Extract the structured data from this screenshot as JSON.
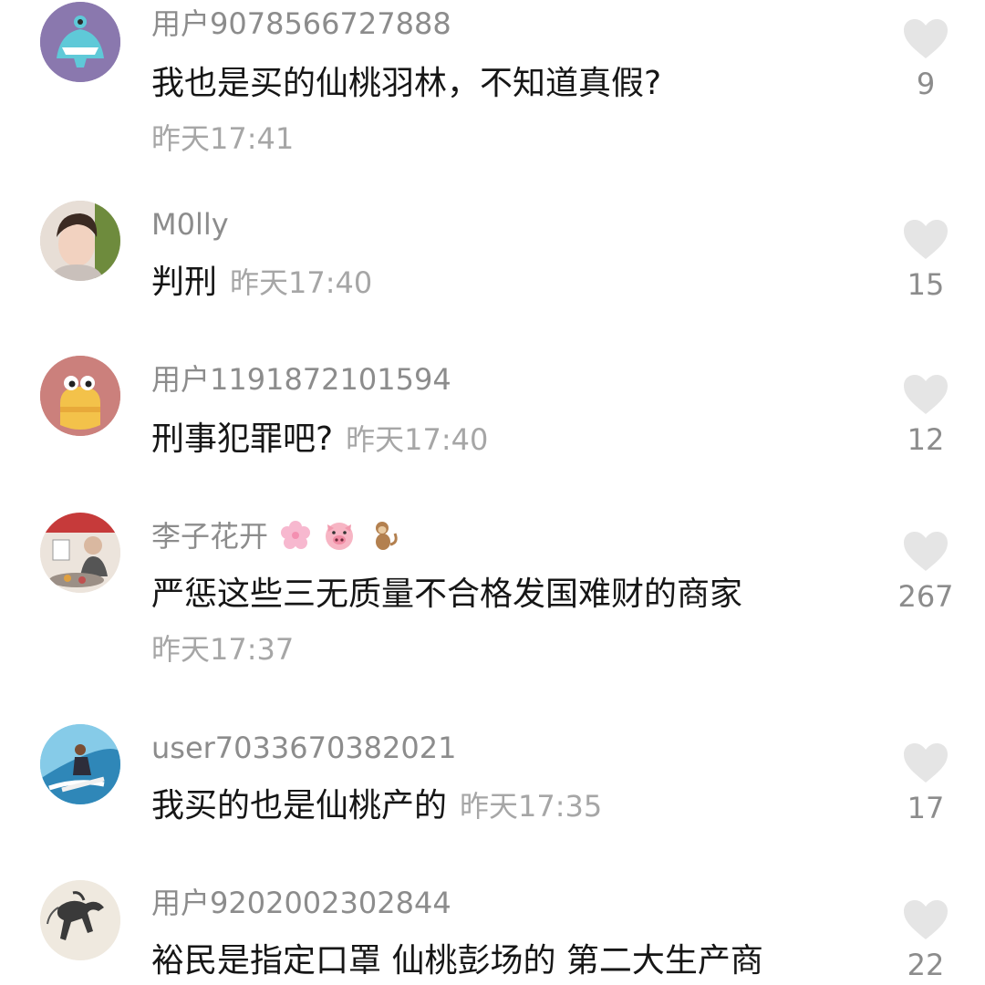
{
  "comments": [
    {
      "user": "用户9078566727888",
      "text": "我也是买的仙桃羽林，不知道真假?",
      "time": "昨天17:41",
      "likes": "9"
    },
    {
      "user": "M0lly",
      "text": "判刑",
      "time": "昨天17:40",
      "likes": "15"
    },
    {
      "user": "用户1191872101594",
      "text": "刑事犯罪吧?",
      "time": "昨天17:40",
      "likes": "12"
    },
    {
      "user": "李子花开",
      "text": "严惩这些三无质量不合格发国难财的商家",
      "time": "昨天17:37",
      "likes": "267",
      "user_emojis": [
        "cherry-blossom-icon",
        "pig-face-icon",
        "monkey-icon"
      ]
    },
    {
      "user": "user7033670382021",
      "text": "我买的也是仙桃产的",
      "time": "昨天17:35",
      "likes": "17"
    },
    {
      "user": "用户9202002302844",
      "text": "裕民是指定口罩 仙桃彭场的 第二大生产商",
      "time": "",
      "likes": "22"
    }
  ],
  "icons": {
    "like": "heart-icon"
  },
  "colors": {
    "heart": "#e5e5e5",
    "username": "#8c8c8c",
    "time": "#a6a6a6",
    "text": "#161616"
  }
}
